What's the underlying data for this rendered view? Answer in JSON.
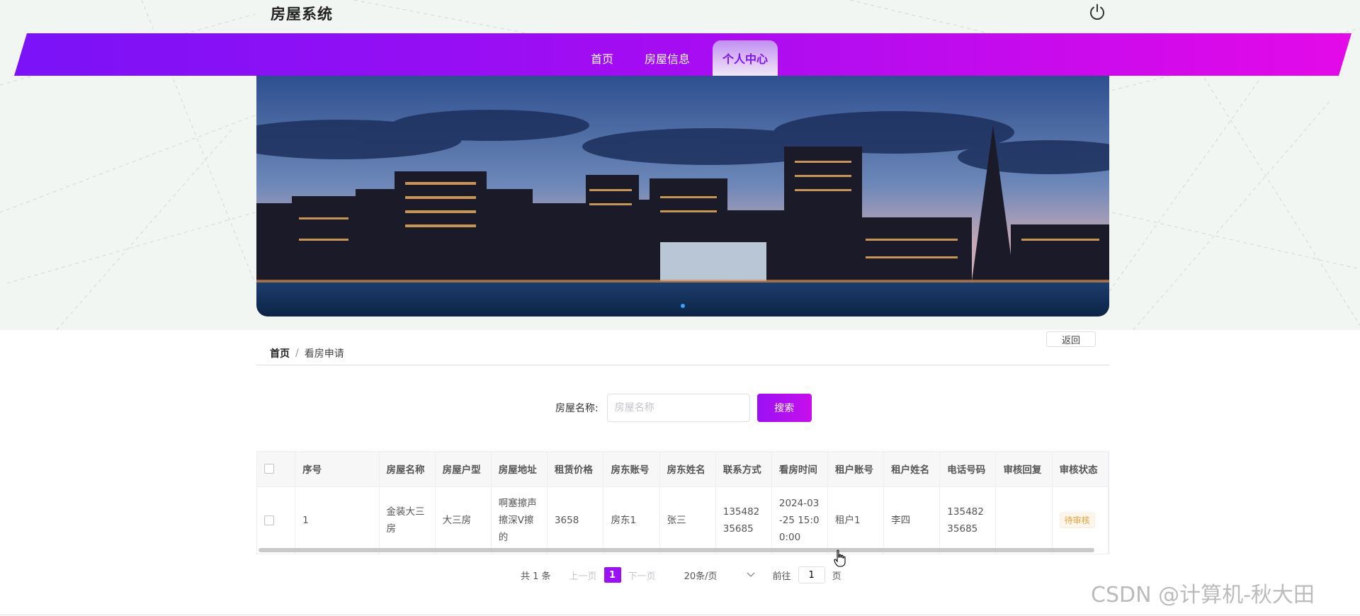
{
  "app": {
    "title": "房屋系统"
  },
  "nav": {
    "items": [
      {
        "label": "首页"
      },
      {
        "label": "房屋信息"
      },
      {
        "label": "个人中心"
      }
    ],
    "active_index": 2
  },
  "icons": {
    "power": "power-icon",
    "cursor": "hand-cursor-icon"
  },
  "toolbar": {
    "return_label": "返回"
  },
  "breadcrumb": {
    "home": "首页",
    "separator": "/",
    "current": "看房申请"
  },
  "search": {
    "label": "房屋名称:",
    "placeholder": "房屋名称",
    "value": "",
    "button_label": "搜索"
  },
  "table": {
    "columns": [
      "序号",
      "房屋名称",
      "房屋户型",
      "房屋地址",
      "租赁价格",
      "房东账号",
      "房东姓名",
      "联系方式",
      "看房时间",
      "租户账号",
      "租户姓名",
      "电话号码",
      "审核回复",
      "审核状态"
    ],
    "rows": [
      {
        "index": "1",
        "house_name": "金装大三房",
        "layout": "大三房",
        "address": "啊塞擦声擦深V擦的",
        "price": "3658",
        "landlord_account": "房东1",
        "landlord_name": "张三",
        "contact": "13548235685",
        "view_time": "2024-03-25 15:00:00",
        "tenant_account": "租户1",
        "tenant_name": "李四",
        "phone": "13548235685",
        "reply": "",
        "status": "待审核"
      }
    ]
  },
  "pagination": {
    "total_text": "共 1 条",
    "prev": "上一页",
    "current_page": "1",
    "next": "下一页",
    "page_size": "20条/页",
    "goto_label": "前往",
    "goto_value": "1",
    "goto_suffix": "页"
  },
  "watermark": "CSDN @计算机-秋大田",
  "colors": {
    "accent_start": "#7a12f7",
    "accent_end": "#e40ae8",
    "button": "#9b10f4",
    "status_pending": "#e6a23c"
  }
}
